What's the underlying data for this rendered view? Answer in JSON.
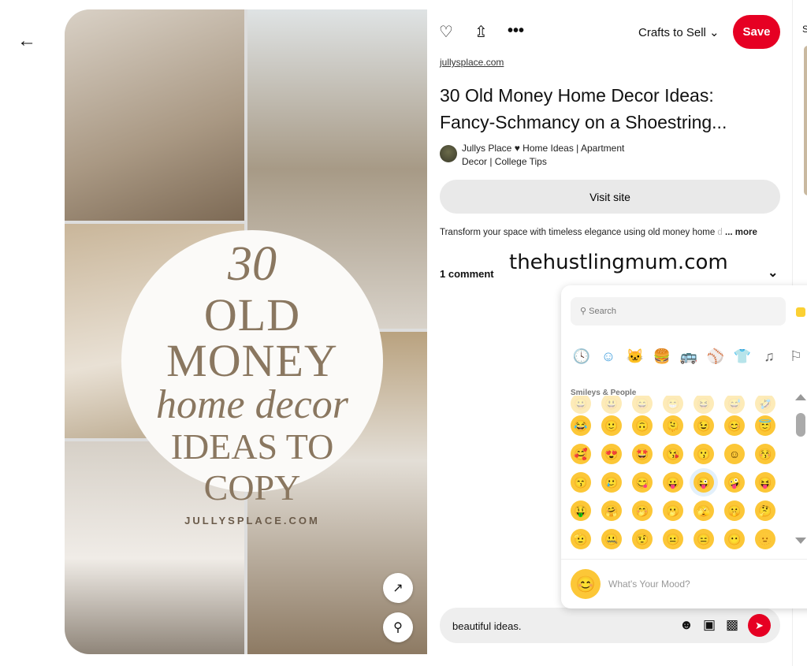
{
  "nav": {
    "back_icon": "arrow-left-icon"
  },
  "pin_image": {
    "overlay": {
      "line1": "30",
      "line2": "OLD MONEY",
      "line3": "home decor",
      "line4": "IDEAS TO COPY",
      "line5": "JULLYSPLACE.COM"
    },
    "expand_icon": "expand-icon",
    "lens_icon": "visual-search-icon"
  },
  "toolbar": {
    "board_label": "Crafts to Sell",
    "save_label": "Save",
    "icons": [
      "heart-icon",
      "share-icon",
      "more-icon"
    ]
  },
  "pin": {
    "source": "jullysplace.com",
    "title": "30 Old Money Home Decor Ideas: Fancy-Schmancy on a Shoestring...",
    "author": "Jullys Place ♥ Home Ideas | Apartment Decor | College Tips",
    "visit_label": "Visit site",
    "description": "Transform your space with timeless elegance using old money home",
    "description_fade": " d",
    "more_label": "... more",
    "comments_label": "1 comment"
  },
  "watermark": "thehustlingmum.com",
  "edge": {
    "letter": "S"
  },
  "emoji_picker": {
    "search_placeholder": "Search",
    "categories": [
      "🕓",
      "☺",
      "🐱",
      "🍔",
      "🚌",
      "⚾",
      "👕",
      "♫",
      "⚐"
    ],
    "active_category": 1,
    "section_label": "Smileys & People",
    "rows": [
      [
        "😀",
        "😃",
        "😄",
        "😁",
        "😆",
        "😅",
        "🤣"
      ],
      [
        "😂",
        "🙂",
        "🙃",
        "🫠",
        "😉",
        "😊",
        "😇"
      ],
      [
        "🥰",
        "😍",
        "🤩",
        "😘",
        "😗",
        "☺",
        "😚"
      ],
      [
        "😙",
        "🥲",
        "😋",
        "😛",
        "😜",
        "🤪",
        "😝"
      ],
      [
        "🤑",
        "🤗",
        "🤭",
        "🫢",
        "🫣",
        "🤫",
        "🤔"
      ],
      [
        "🫡",
        "🤐",
        "🤨",
        "😐",
        "😑",
        "😶",
        "🫥"
      ]
    ],
    "selected": "😜",
    "mood_emoji": "😊",
    "mood_placeholder": "What's Your Mood?"
  },
  "comment_box": {
    "value": "beautiful ideas.",
    "icons": [
      "emoji-icon",
      "sticker-icon",
      "image-icon",
      "send-icon"
    ]
  }
}
